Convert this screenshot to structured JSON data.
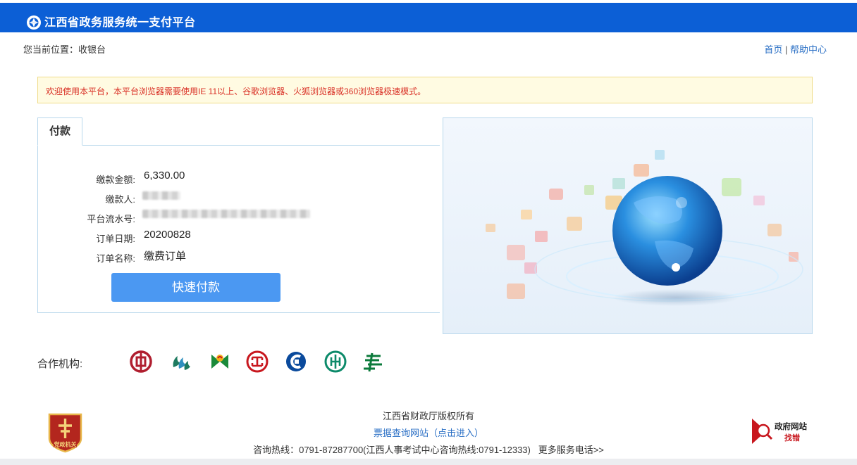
{
  "header": {
    "title": "江西省政务服务统一支付平台"
  },
  "breadcrumb": {
    "text": "您当前位置：收银台"
  },
  "toplinks": {
    "home": "首页",
    "separator": "|",
    "help": "帮助中心"
  },
  "notice": {
    "text": "欢迎使用本平台，本平台浏览器需要使用IE 11以上、谷歌浏览器、火狐浏览器或360浏览器极速模式。"
  },
  "payment": {
    "tab_label": "付款",
    "fields": [
      {
        "label": "缴款金额:",
        "value": "6,330.00"
      },
      {
        "label": "缴款人:",
        "value": ""
      },
      {
        "label": "平台流水号:",
        "value": ""
      },
      {
        "label": "订单日期:",
        "value": "20200828"
      },
      {
        "label": "订单名称:",
        "value": "缴费订单"
      }
    ],
    "pay_button": "快速付款"
  },
  "partners": {
    "label": "合作机构:",
    "banks": [
      {
        "icon": "bank-of-china-icon",
        "color": "#b01e2f"
      },
      {
        "icon": "huaxia-bank-icon",
        "color": "#1d7a5f"
      },
      {
        "icon": "rural-credit-icon",
        "color": "#1a8a3a"
      },
      {
        "icon": "icbc-icon",
        "color": "#c8171e"
      },
      {
        "icon": "ccb-icon",
        "color": "#0a4a9c"
      },
      {
        "icon": "abc-icon",
        "color": "#0c8a6a"
      },
      {
        "icon": "postal-savings-icon",
        "color": "#0b7a3b"
      }
    ]
  },
  "footer": {
    "copyright": "江西省财政厅版权所有",
    "link": "票据查询网站（点击进入）",
    "hotline": "咨询热线：0791-87287700(江西人事考试中心咨询热线:0791-12333)",
    "more": "更多服务电话>>",
    "badge_text": "党政机关",
    "gov_logo_line1": "政府网站",
    "gov_logo_line2": "找错"
  },
  "colors": {
    "header": "#0c5fd6",
    "button": "#4b98f2",
    "notice_text": "#d93025",
    "link": "#2a6fc5"
  }
}
